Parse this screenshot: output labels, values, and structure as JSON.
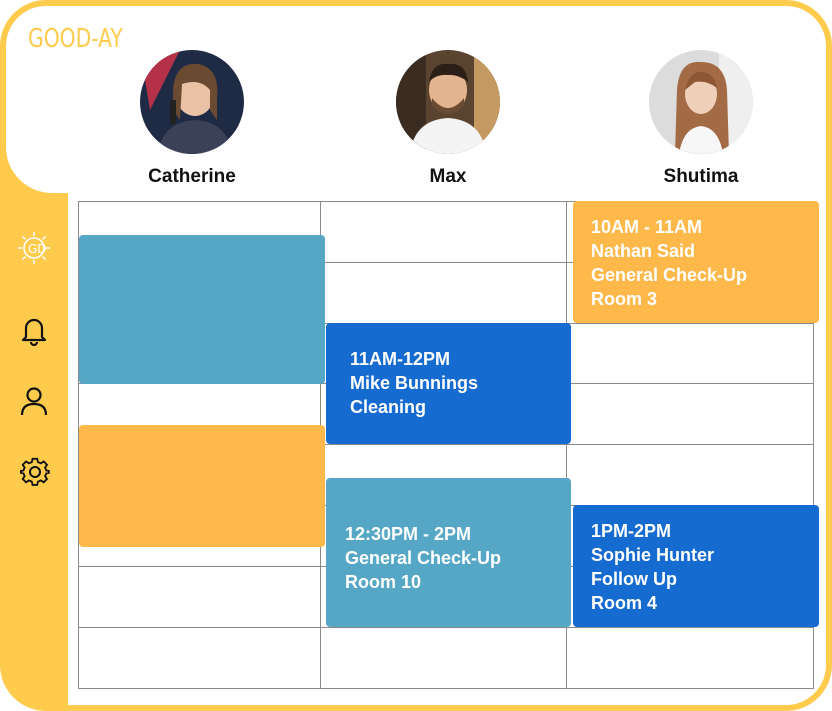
{
  "app": {
    "logo": "GOOD-AY"
  },
  "staff": [
    {
      "name": "Catherine"
    },
    {
      "name": "Max"
    },
    {
      "name": "Shutima"
    }
  ],
  "sidebar": {
    "icons": [
      "gooday-sun-icon",
      "bell-icon",
      "user-icon",
      "gear-icon"
    ]
  },
  "appointments": {
    "shutima_1": {
      "time": "10AM - 11AM",
      "patient": "Nathan Said",
      "service": "General Check-Up",
      "room": "Room 3"
    },
    "max_1": {
      "time": "11AM-12PM",
      "patient": "Mike Bunnings",
      "service": "Cleaning"
    },
    "max_2": {
      "time": "12:30PM - 2PM",
      "service": "General Check-Up",
      "room": "Room 10"
    },
    "shutima_2": {
      "time": "1PM-2PM",
      "patient": "Sophie Hunter",
      "service": "Follow Up",
      "room": "Room 4"
    }
  },
  "colors": {
    "yellow": "#ffcb4d",
    "orange": "#ffb84a",
    "teal": "#56a7c5",
    "blue": "#156bd0"
  }
}
